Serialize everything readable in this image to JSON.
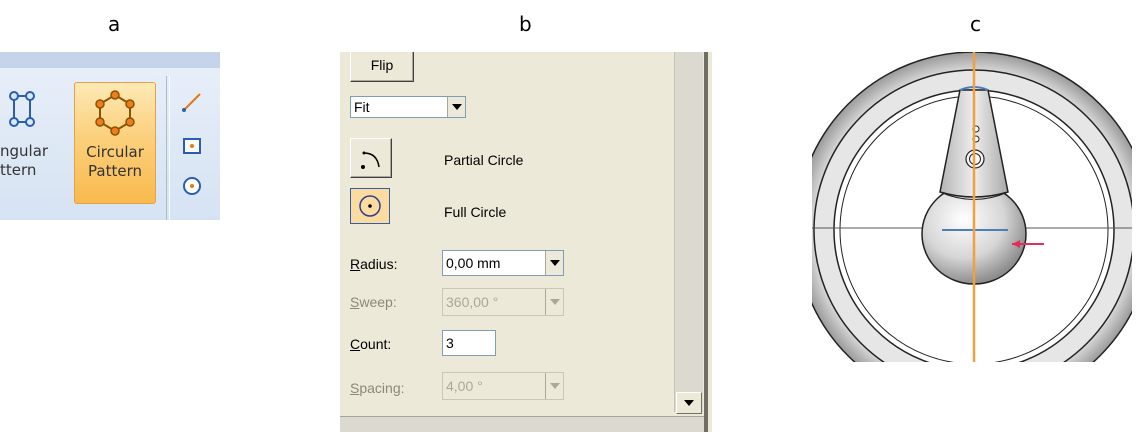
{
  "panel_labels": {
    "a": "a",
    "b": "b",
    "c": "c"
  },
  "ribbon": {
    "angular_label_1": "ngular",
    "angular_label_2": "ttern",
    "circular_label_1": "Circular",
    "circular_label_2": "Pattern",
    "small_icons": [
      "line-icon",
      "rectangle-icon",
      "circle-icon"
    ],
    "active_color": "#f9b94e"
  },
  "dialog": {
    "flip_label": "Flip",
    "fit_value": "Fit",
    "partial_circle_label": "Partial Circle",
    "full_circle_label": "Full Circle",
    "radius": {
      "accel": "R",
      "rest": "adius:",
      "value": "0,00 mm"
    },
    "sweep": {
      "accel": "S",
      "rest": "weep:",
      "value": "360,00 °"
    },
    "count": {
      "accel": "C",
      "rest": "ount:",
      "value": "3"
    },
    "spacing": {
      "accel": "S",
      "rest": "pacing:",
      "value": "4,00 °"
    }
  },
  "view3d": {
    "axis_color": "#f0a040",
    "marker_color": "#e0305a"
  }
}
